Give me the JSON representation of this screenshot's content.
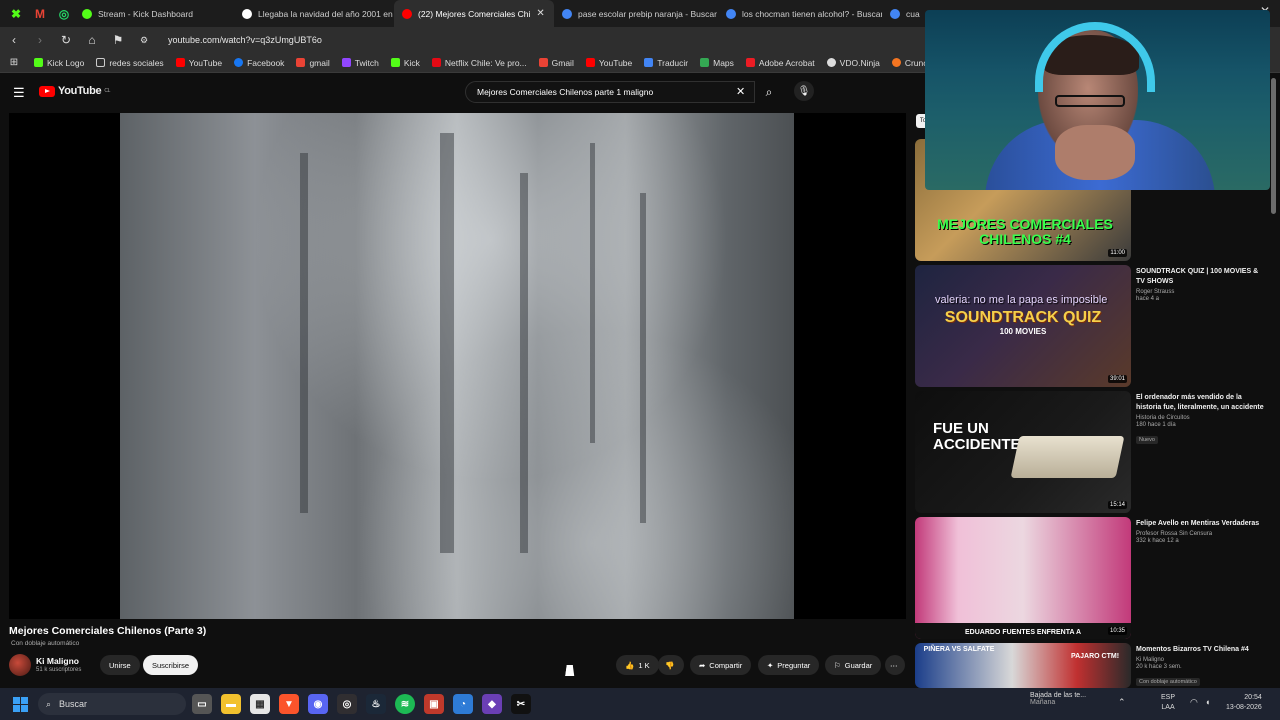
{
  "browser": {
    "pinned": [
      "kick-icon",
      "gmail-icon",
      "whatsapp-icon"
    ],
    "tabs": [
      {
        "label": "Stream - Kick Dashboard",
        "color": "#53fc18",
        "active": false
      },
      {
        "label": "Llegaba la navidad del año 2001 en C",
        "color": "#000000",
        "active": false
      },
      {
        "label": "(22) Mejores Comerciales Chi",
        "color": "#ff0000",
        "active": true
      },
      {
        "label": "pase escolar prebip naranja - Buscar",
        "color": "#4285f4",
        "active": false
      },
      {
        "label": "los chocman tienen alcohol? - Buscar",
        "color": "#4285f4",
        "active": false
      },
      {
        "label": "cua",
        "color": "#4285f4",
        "active": false
      }
    ],
    "url": "youtube.com/watch?v=q3zUmgUBT6o",
    "bookmarks": [
      {
        "label": "Kick Logo",
        "color": "#53fc18"
      },
      {
        "label": "redes sociales",
        "color": "#cccccc"
      },
      {
        "label": "YouTube",
        "color": "#ff0000"
      },
      {
        "label": "Facebook",
        "color": "#1877f2"
      },
      {
        "label": "gmail",
        "color": "#ea4335"
      },
      {
        "label": "Twitch",
        "color": "#9146ff"
      },
      {
        "label": "Kick",
        "color": "#53fc18"
      },
      {
        "label": "Netflix Chile: Ve pro...",
        "color": "#e50914"
      },
      {
        "label": "Gmail",
        "color": "#ea4335"
      },
      {
        "label": "YouTube",
        "color": "#ff0000"
      },
      {
        "label": "Traducir",
        "color": "#4285f4"
      },
      {
        "label": "Maps",
        "color": "#34a853"
      },
      {
        "label": "Adobe Acrobat",
        "color": "#ec1c24"
      },
      {
        "label": "VDO.Ninja",
        "color": "#dddddd"
      },
      {
        "label": "Crunchyroll",
        "color": "#f47521"
      }
    ]
  },
  "youtube": {
    "logo": "YouTube",
    "country": "CL",
    "search_value": "Mejores Comerciales Chilenos parte 1 maligno",
    "video": {
      "title": "Mejores Comerciales Chilenos (Parte 3)",
      "dub_note": "Con doblaje automático",
      "channel": "Ki Maligno",
      "subscribers": "51 k suscriptores",
      "join": "Unirse",
      "subscribe": "Suscribirse",
      "likes": "1 K",
      "share": "Compartir",
      "ask": "Preguntar",
      "save": "Guardar"
    },
    "chip": "To",
    "recommendations": [
      {
        "title": "",
        "channel": "",
        "meta": "",
        "duration": "11:00",
        "thumb_text": "MEJORES COMERCIALES CHILENOS #4"
      },
      {
        "title": "SOUNDTRACK QUIZ | 100 MOVIES & TV SHOWS",
        "channel": "Roger Strauss",
        "meta": "hace 4 a",
        "duration": "39:01",
        "thumb_text": "SOUNDTRACK QUIZ",
        "thumb_sub": "100 MOVIES",
        "overlay": "valeria: no me la papa es imposible"
      },
      {
        "title": "El ordenador más vendido de la historia fue, literalmente, un accidente",
        "channel": "Historia de Circuitos",
        "meta": "180  hace 1 día",
        "badge": "Nuevo",
        "duration": "15:14",
        "thumb_text": "FUE UN ACCIDENTE"
      },
      {
        "title": "Felipe Avello en Mentiras Verdaderas",
        "channel": "Profesor Rossa Sin Censura",
        "meta": "332 k  hace 12 a",
        "duration": "10:35",
        "thumb_text": "EDUARDO FUENTES ENFRENTA A"
      },
      {
        "title": "Momentos Bizarros TV Chilena #4",
        "channel": "Ki Maligno",
        "meta": "20 k  hace 3 sem.",
        "badge": "Con doblaje automático",
        "duration": "",
        "thumb_text": "PIÑERA VS SALFATE",
        "thumb_sub": "PAJARO CTM!"
      }
    ]
  },
  "taskbar": {
    "search": "Buscar",
    "weather_title": "Bajada de las te...",
    "weather_sub": "Mañana",
    "lang_top": "ESP",
    "lang_bottom": "LAA",
    "time": "20:54",
    "date": "13-08-2026"
  }
}
